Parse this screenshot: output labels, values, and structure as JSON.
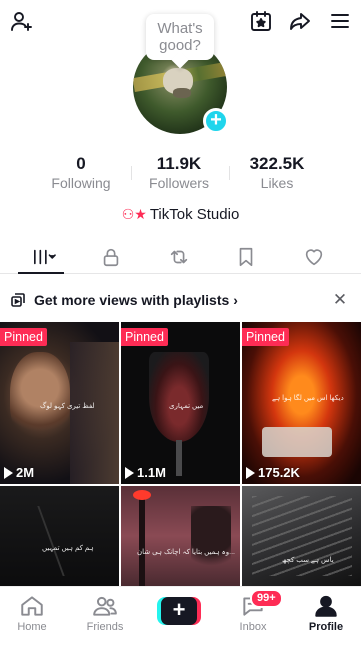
{
  "header": {
    "bubble_text": "What's good?"
  },
  "stats": [
    {
      "value": "0",
      "label": "Following"
    },
    {
      "value": "11.9K",
      "label": "Followers"
    },
    {
      "value": "322.5K",
      "label": "Likes"
    }
  ],
  "studio_label": "TikTok Studio",
  "playlist_banner": {
    "text": "Get more views with playlists",
    "chevron": "›",
    "close": "✕"
  },
  "videos": [
    {
      "pinned": "Pinned",
      "views": "2M",
      "caption": "لفظ تیری کہو لوگ"
    },
    {
      "pinned": "Pinned",
      "views": "1.1M",
      "caption": "میں تمہاری"
    },
    {
      "pinned": "Pinned",
      "views": "175.2K",
      "caption": "دیکھا اس میں لگا ہوا ہے"
    },
    {
      "caption": "ہم کم ہیں تمہیں"
    },
    {
      "caption": "وہ ہمیں بتایا کہ اچانک ہی شان..."
    },
    {
      "caption": "یاس ہے سب کچھ"
    }
  ],
  "bottom_nav": {
    "home": "Home",
    "friends": "Friends",
    "create": "+",
    "inbox": "Inbox",
    "inbox_badge": "99+",
    "profile": "Profile"
  }
}
